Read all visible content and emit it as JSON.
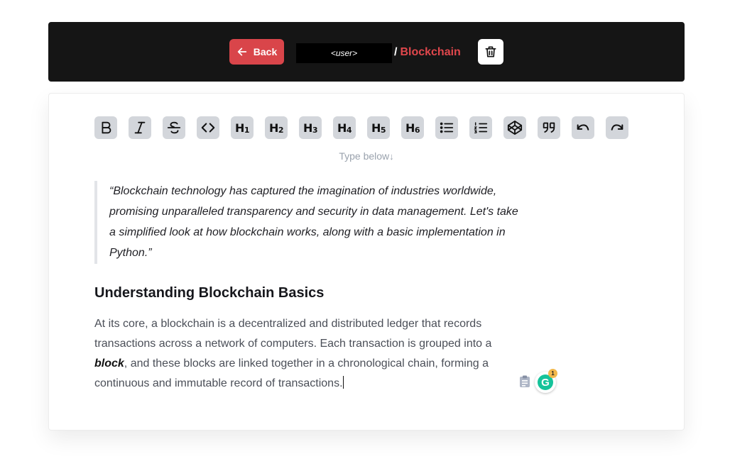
{
  "header": {
    "back_label": "Back",
    "user_label": "<user>",
    "separator": "/",
    "document_title": "Blockchain",
    "colors": {
      "bar": "#151515",
      "accent": "#d9454a"
    }
  },
  "toolbar": {
    "buttons": [
      {
        "name": "bold",
        "icon": "bold-icon"
      },
      {
        "name": "italic",
        "icon": "italic-icon"
      },
      {
        "name": "strikethrough",
        "icon": "strikethrough-icon"
      },
      {
        "name": "code",
        "icon": "code-icon"
      },
      {
        "name": "h1",
        "label": "H",
        "sub": "1"
      },
      {
        "name": "h2",
        "label": "H",
        "sub": "2"
      },
      {
        "name": "h3",
        "label": "H",
        "sub": "3"
      },
      {
        "name": "h4",
        "label": "H",
        "sub": "4"
      },
      {
        "name": "h5",
        "label": "H",
        "sub": "5"
      },
      {
        "name": "h6",
        "label": "H",
        "sub": "6"
      },
      {
        "name": "bullet-list",
        "icon": "bullet-list-icon"
      },
      {
        "name": "ordered-list",
        "icon": "ordered-list-icon"
      },
      {
        "name": "code-block",
        "icon": "codepen-icon"
      },
      {
        "name": "blockquote",
        "icon": "quote-icon"
      },
      {
        "name": "undo",
        "icon": "undo-icon"
      },
      {
        "name": "redo",
        "icon": "redo-icon"
      }
    ]
  },
  "editor": {
    "hint": "Type below",
    "quote_lines": [
      "“Blockchain technology has captured the imagination of industries worldwide,",
      "promising unparalleled transparency and security in data management. Let's take",
      "a simplified look at how blockchain works, along with a basic implementation in",
      "Python.”"
    ],
    "heading": "Understanding Blockchain Basics",
    "paragraph": {
      "line1": "At its core, a blockchain is a decentralized and distributed ledger that records",
      "line2": "transactions across a network of computers. Each transaction is grouped into a",
      "bold_word": "block",
      "line3_rest": ", and these blocks are linked together in a chronological chain, forming a",
      "line4": "continuous and immutable record of transactions."
    }
  },
  "extensions": {
    "grammarly_letter": "G",
    "grammarly_count": "1"
  }
}
